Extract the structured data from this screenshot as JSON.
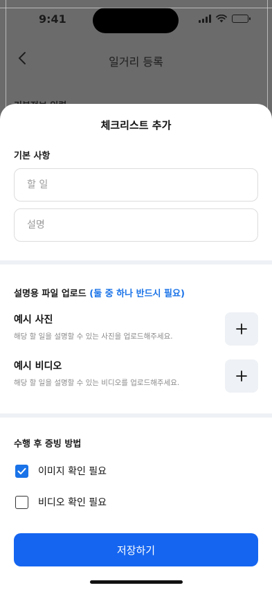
{
  "status": {
    "time": "9:41"
  },
  "background": {
    "title": "일거리 등록",
    "section_label": "기본정보 입력"
  },
  "sheet": {
    "title": "체크리스트 추가",
    "basic": {
      "label": "기본 사항",
      "todo_placeholder": "할 일",
      "desc_placeholder": "설명"
    },
    "upload": {
      "label": "설명용 파일 업로드",
      "hint": "(둘 중 하나 반드시 필요)",
      "items": [
        {
          "title": "예시 사진",
          "desc": "해당 할 일을 설명할 수 있는 사진을 업로드해주세요.",
          "button": "+"
        },
        {
          "title": "예시 비디오",
          "desc": "해당 할 일을 설명할 수 있는 비디오를 업로드해주세요.",
          "button": "+"
        }
      ]
    },
    "proof": {
      "label": "수행 후 증빙 방법",
      "options": [
        {
          "label": "이미지 확인 필요",
          "checked": true
        },
        {
          "label": "비디오 확인 필요",
          "checked": false
        }
      ]
    },
    "save_label": "저장하기"
  },
  "colors": {
    "accent": "#1565f0",
    "hint": "#1a73e8",
    "dim": "#6b6b6b",
    "chip": "#eef1f5"
  }
}
